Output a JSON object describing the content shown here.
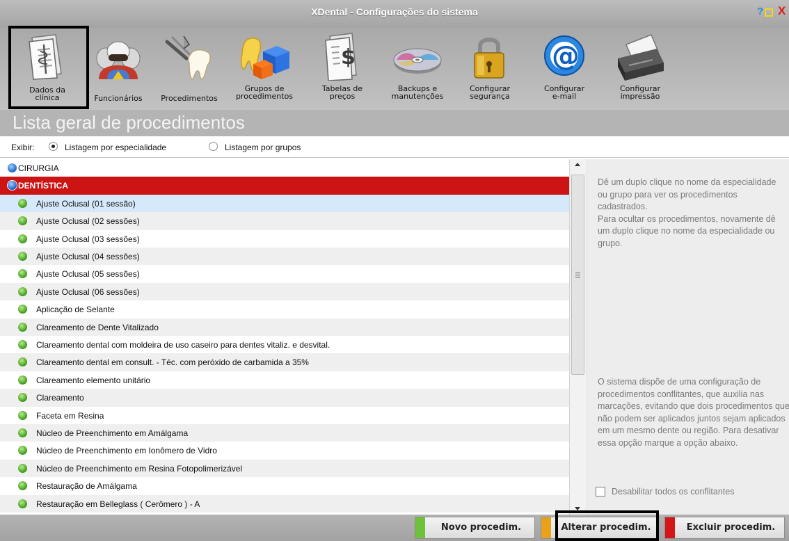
{
  "window": {
    "title": "XDental - Configurações do sistema",
    "help_glyph": "?",
    "close_glyph": "X"
  },
  "toolbar": {
    "items": [
      {
        "label": "Dados da\nclínica",
        "icon": "clinic-document-icon"
      },
      {
        "label": "Funcionários",
        "icon": "staff-group-icon"
      },
      {
        "label": "Procedimentos",
        "icon": "dental-tools-icon"
      },
      {
        "label": "Grupos de\nprocedimentos",
        "icon": "procedure-groups-icon"
      },
      {
        "label": "Tabelas de\npreços",
        "icon": "price-table-icon"
      },
      {
        "label": "Backups e\nmanutenções",
        "icon": "backup-disc-icon"
      },
      {
        "label": "Configurar\nsegurança",
        "icon": "padlock-icon"
      },
      {
        "label": "Configurar\ne-mail",
        "icon": "email-at-icon"
      },
      {
        "label": "Configurar\nimpressão",
        "icon": "printer-icon"
      }
    ]
  },
  "section": {
    "title": "Lista geral de procedimentos"
  },
  "filter": {
    "label": "Exibir:",
    "options": [
      "Listagem por especialidade",
      "Listagem por grupos"
    ],
    "selected": "Listagem por especialidade"
  },
  "list": {
    "rows": [
      {
        "kind": "category",
        "text": "CIRURGIA"
      },
      {
        "kind": "category",
        "text": "DENTÍSTICA",
        "selected": true
      },
      {
        "kind": "procedure",
        "text": "Ajuste Oclusal (01 sessão)",
        "selected": true
      },
      {
        "kind": "procedure",
        "text": "Ajuste Oclusal (02 sessões)"
      },
      {
        "kind": "procedure",
        "text": "Ajuste Oclusal (03 sessões)"
      },
      {
        "kind": "procedure",
        "text": "Ajuste Oclusal (04 sessões)"
      },
      {
        "kind": "procedure",
        "text": "Ajuste Oclusal (05 sessões)"
      },
      {
        "kind": "procedure",
        "text": "Ajuste Oclusal (06 sessões)"
      },
      {
        "kind": "procedure",
        "text": "Aplicação de Selante"
      },
      {
        "kind": "procedure",
        "text": "Clareamento de Dente Vitalizado"
      },
      {
        "kind": "procedure",
        "text": "Clareamento dental com moldeira de uso caseiro para dentes vitaliz. e desvital."
      },
      {
        "kind": "procedure",
        "text": "Clareamento dental em consult. - Téc. com peróxido de carbamida a 35%"
      },
      {
        "kind": "procedure",
        "text": "Clareamento elemento unitário"
      },
      {
        "kind": "procedure",
        "text": "Clareamento"
      },
      {
        "kind": "procedure",
        "text": "Faceta em Resina"
      },
      {
        "kind": "procedure",
        "text": "Núcleo de Preenchimento em Amálgama"
      },
      {
        "kind": "procedure",
        "text": "Núcleo de Preenchimento em Ionômero de Vidro"
      },
      {
        "kind": "procedure",
        "text": "Núcleo de Preenchimento em Resina Fotopolimerizável"
      },
      {
        "kind": "procedure",
        "text": "Restauração de Amálgama"
      },
      {
        "kind": "procedure",
        "text": "Restauração em  Belleglass ( Cerômero ) - A"
      }
    ]
  },
  "side_panel": {
    "help_top": "Dê um duplo clique no nome da especialidade ou grupo para ver os procedimentos cadastrados.\nPara ocultar os procedimentos, novamente dê um duplo clique no nome da especialidade ou grupo.",
    "help_conflicts": "O sistema dispõe de uma configuração de procedimentos conflitantes, que auxilia nas marcações, evitando que dois procedimentos que não podem ser aplicados juntos sejam aplicados em um mesmo dente ou região. Para desativar essa opção marque a opção abaixo.",
    "checkbox_label": "Desabilitar todos os conflitantes",
    "checkbox_checked": false
  },
  "footer": {
    "buttons": [
      {
        "label": "Novo procedim.",
        "color": "#6cc23a"
      },
      {
        "label": "Alterar procedim.",
        "color": "#e8a21a"
      },
      {
        "label": "Excluir procedim.",
        "color": "#d41616"
      }
    ]
  },
  "colors": {
    "category_selected_bg": "#cc1414",
    "procedure_selected_bg": "#d6e9fa",
    "toolbar_bg": "#b4b4b4"
  }
}
